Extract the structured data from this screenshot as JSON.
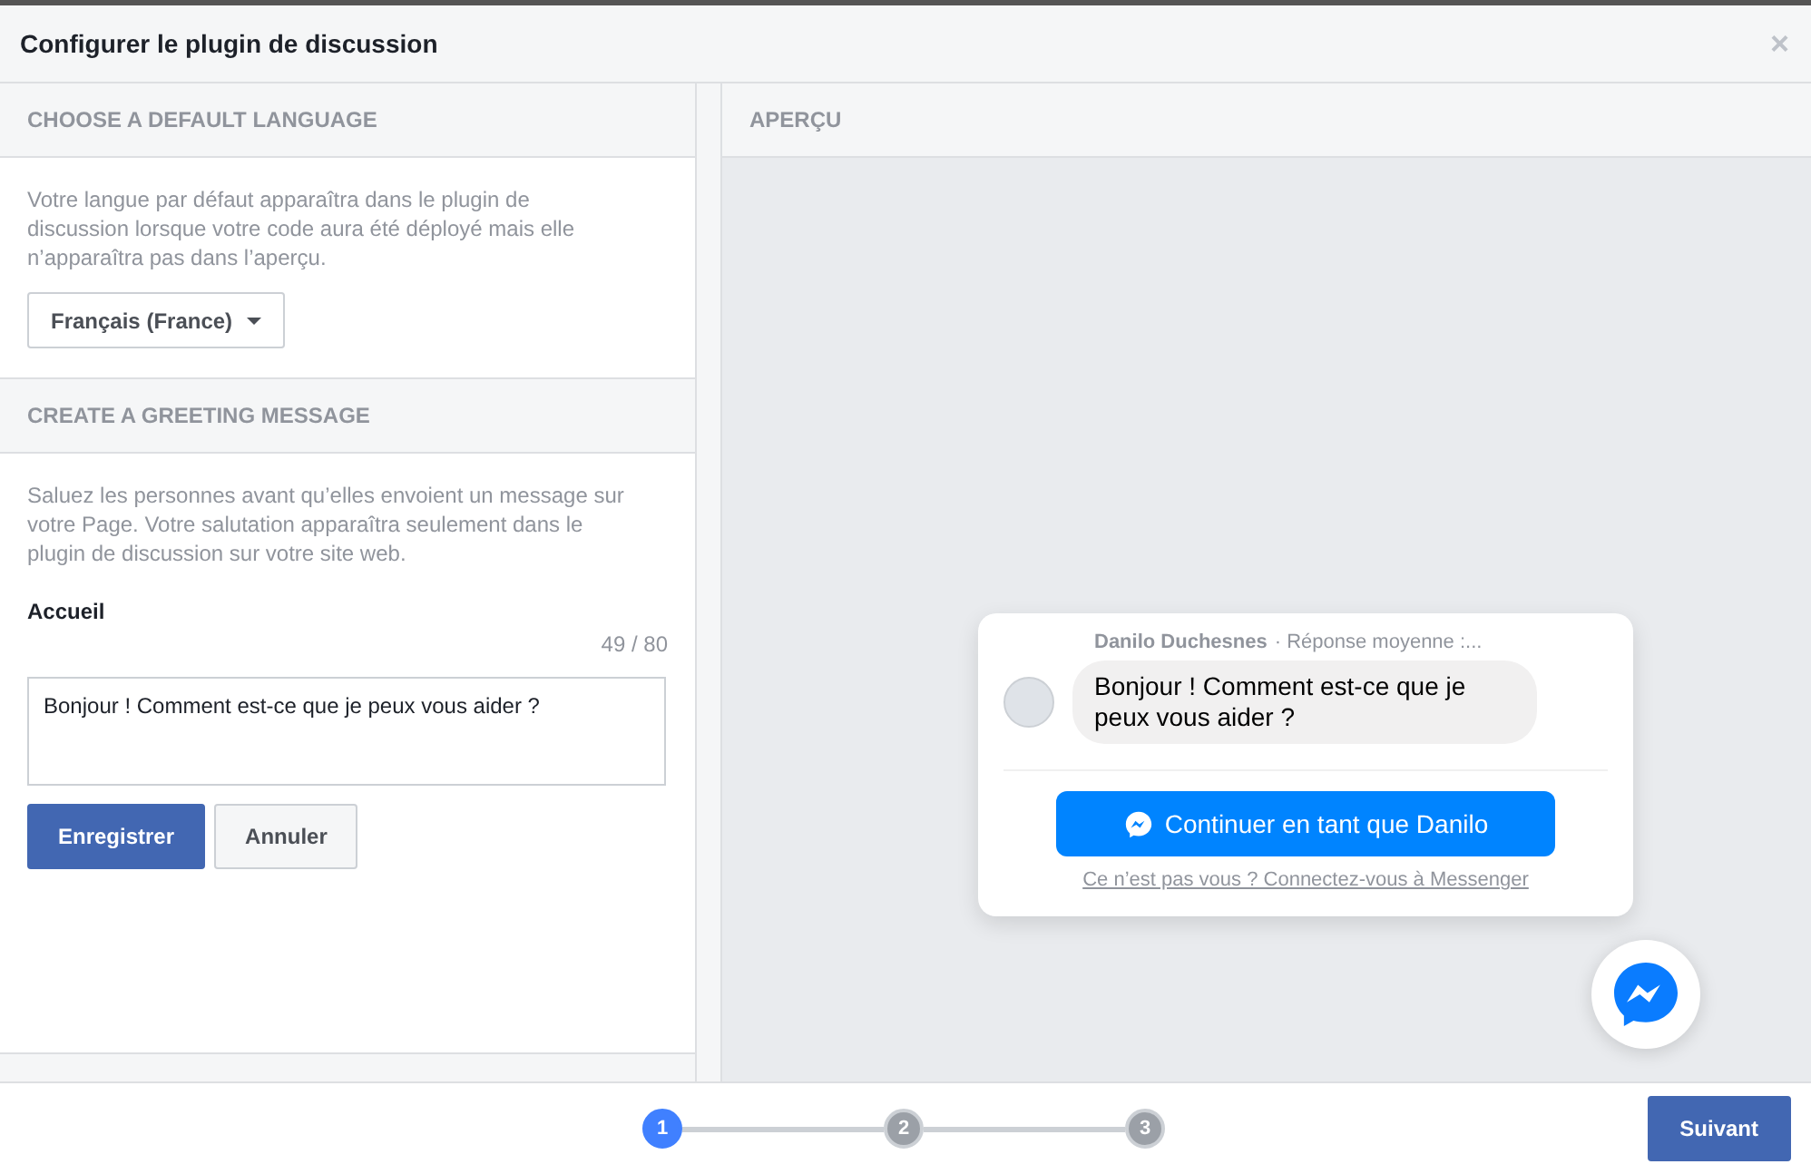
{
  "dialog": {
    "title": "Configurer le plugin de discussion",
    "close": "×"
  },
  "language_section": {
    "heading": "CHOOSE A DEFAULT LANGUAGE",
    "description": "Votre langue par défaut apparaîtra dans le plugin de discussion lorsque votre code aura été déployé mais elle n’apparaîtra pas dans l’aperçu.",
    "dropdown": "Français (France)"
  },
  "greeting_section": {
    "heading": "CREATE A GREETING MESSAGE",
    "description": "Saluez les personnes avant qu’elles envoient un message sur votre Page. Votre salutation apparaîtra seulement dans le plugin de discussion sur votre site web.",
    "field_label": "Accueil",
    "counter": "49 / 80",
    "value": "Bonjour ! Comment est-ce que je peux vous aider ?",
    "buttons": [
      {
        "label": "Enregistrer",
        "kind": "primary"
      },
      {
        "label": "Annuler",
        "kind": "secondary"
      }
    ]
  },
  "preview": {
    "heading": "APERÇU",
    "sender": "Danilo Duchesnes",
    "meta": "· Réponse moyenne :...",
    "message": "Bonjour ! Comment est-ce que je peux vous aider ?",
    "continue_button": "Continuer en tant que Danilo",
    "switch_link": "Ce n’est pas vous ? Connectez-vous à Messenger"
  },
  "steps": [
    {
      "label": "1",
      "selected": true
    },
    {
      "label": "2",
      "selected": false
    },
    {
      "label": "3",
      "selected": false
    }
  ],
  "next_button": "Suivant"
}
